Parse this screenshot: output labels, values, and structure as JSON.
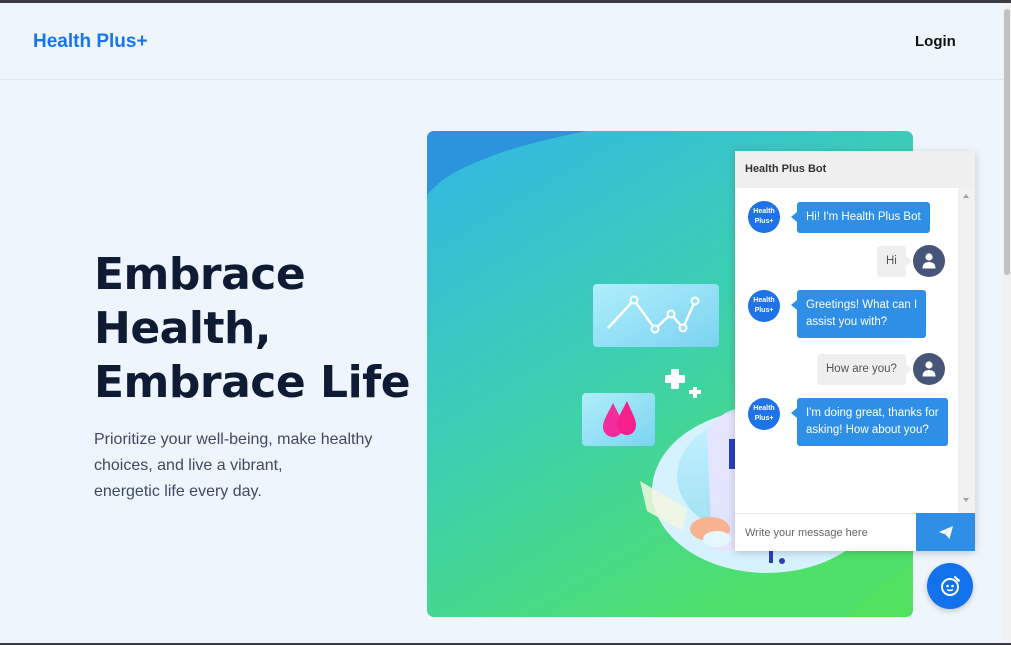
{
  "nav": {
    "brand": "Health Plus+",
    "login": "Login"
  },
  "hero": {
    "headline": [
      "Embrace",
      "Health,",
      "Embrace Life"
    ],
    "subtext": [
      "Prioritize your well-being, make healthy",
      "choices, and live a vibrant,",
      "energetic life every day."
    ]
  },
  "chat": {
    "title": "Health Plus Bot",
    "bot_avatar_text": [
      "Health",
      "Plus+"
    ],
    "messages": [
      {
        "from": "bot",
        "lines": [
          "Hi! I'm Health Plus Bot"
        ]
      },
      {
        "from": "user",
        "lines": [
          "Hi"
        ]
      },
      {
        "from": "bot",
        "lines": [
          "Greetings! What can I",
          "assist you with?"
        ]
      },
      {
        "from": "user",
        "lines": [
          "How are you?"
        ]
      },
      {
        "from": "bot",
        "lines": [
          "I'm doing great, thanks for",
          "asking! How about you?"
        ]
      }
    ],
    "input_placeholder": "Write your message here"
  },
  "icons": {
    "send": "send-icon",
    "user": "user-icon",
    "chat_toggle": "chatbot-icon"
  },
  "colors": {
    "brand": "#1576f0",
    "bot_bubble": "#2f8fe6",
    "user_avatar": "#475578",
    "fab": "#1471ec"
  }
}
